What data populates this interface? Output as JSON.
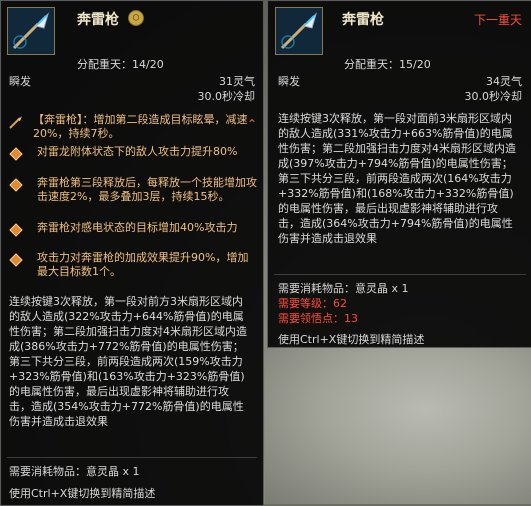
{
  "left": {
    "title": "奔雷枪",
    "assign_label": "分配重天：14/20",
    "cast_type": "瞬发",
    "mana": "31灵气",
    "cooldown": "30.0秒冷却",
    "bonuses": [
      {
        "icon": "spear-icon",
        "text": "【奔雷枪】：增加第二段造成目标眩晕，减速20%，持续7秒。"
      },
      {
        "icon": "diamond-icon",
        "text": "对雷龙附体状态下的敌人攻击力提升80%"
      },
      {
        "icon": "diamond-icon",
        "text": "奔雷枪第三段释放后，每释放一个技能增加攻击速度2%，最多叠加3层，持续15秒。"
      },
      {
        "icon": "diamond-icon",
        "text": "奔雷枪对感电状态的目标增加40%攻击力"
      },
      {
        "icon": "diamond-icon",
        "text": "攻击力对奔雷枪的加成效果提升90%，增加最大目标数1个。"
      }
    ],
    "description": "连续按键3次释放，第一段对前方3米扇形区域内的敌人造成(322%攻击力+644%筋骨值)的电属性伤害；第二段加强扫击力度对4米扇形区域内造成(386%攻击力+772%筋骨值)的电属性伤害；第三下共分三段，前两段造成两次(159%攻击力+323%筋骨值)和(163%攻击力+323%筋骨值)的电属性伤害，最后出现虚影神将辅助进行攻击，造成(354%攻击力+772%筋骨值)的电属性伤害并造成击退效果",
    "consume": "需要消耗物品：意灵晶 x 1",
    "hint": "使用Ctrl+X键切换到精简描述"
  },
  "right": {
    "title": "奔雷枪",
    "next_level": "下一重天",
    "assign_label": "分配重天：15/20",
    "cast_type": "瞬发",
    "mana": "34灵气",
    "cooldown": "30.0秒冷却",
    "description": "连续按键3次释放，第一段对面前3米扇形区域内的敌人造成(331%攻击力+663%筋骨值)的电属性伤害；第二段加强扫击力度对4米扇形区域内造成(397%攻击力+794%筋骨值)的电属性伤害；第三下共分三段，前两段造成两次(164%攻击力+332%筋骨值)和(168%攻击力+332%筋骨值)的电属性伤害，最后出现虚影神将辅助进行攻击，造成(364%攻击力+794%筋骨值)的电属性伤害并造成击退效果",
    "consume": "需要消耗物品：意灵晶 x 1",
    "req_level": "需要等级：62",
    "req_points": "需要领悟点：13",
    "hint": "使用Ctrl+X键切换到精简描述"
  },
  "colors": {
    "bonus_text": "#f0c080",
    "requirement": "#ff4a3a",
    "next_level": "#ff4a3a"
  }
}
